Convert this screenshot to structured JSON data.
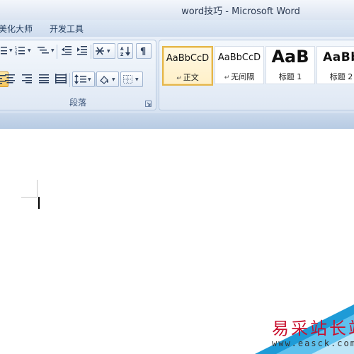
{
  "window": {
    "title_doc": "word技巧",
    "title_sep": "-",
    "title_app": "Microsoft Word"
  },
  "tabs": [
    "美化大师",
    "开发工具"
  ],
  "paragraph_group": {
    "label": "段落",
    "row1_icons": [
      "bullets-icon",
      "numbering-icon",
      "multilevel-list-icon",
      "decrease-indent-icon",
      "increase-indent-icon",
      "chinese-layout-icon",
      "sort-icon",
      "show-marks-icon"
    ],
    "row2_icons": [
      "align-left-icon",
      "align-center-icon",
      "align-right-icon",
      "justify-icon",
      "distributed-icon",
      "line-spacing-icon",
      "shading-icon",
      "borders-icon"
    ]
  },
  "styles_gallery": {
    "items": [
      {
        "preview": "AaBbCcD",
        "name": "正文",
        "mark": "↵",
        "selected": true
      },
      {
        "preview": "AaBbCcD",
        "name": "无间隔",
        "mark": "↵",
        "selected": false
      },
      {
        "preview": "AaB",
        "name": "标题 1",
        "mark": "",
        "selected": false
      },
      {
        "preview": "AaBb",
        "name": "标题 2",
        "mark": "",
        "selected": false
      }
    ]
  },
  "watermark": {
    "text": "易采站长站",
    "url": "www.easck.com"
  },
  "colors": {
    "accent": "#e5b64a",
    "ribbon": "#d6e2f1",
    "watermark": "#c8102e"
  }
}
